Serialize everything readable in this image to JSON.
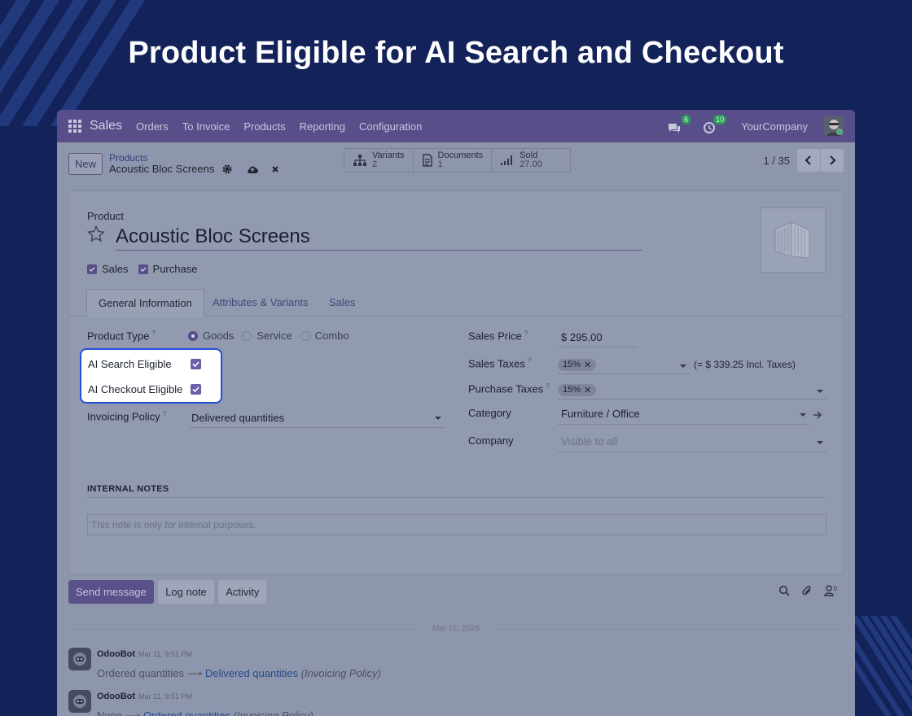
{
  "hero": {
    "title": "Product Eligible for AI Search and Checkout"
  },
  "navbar": {
    "brand": "Sales",
    "items": [
      "Orders",
      "To Invoice",
      "Products",
      "Reporting",
      "Configuration"
    ],
    "messages_count": "6",
    "activities_count": "10",
    "company": "YourCompany"
  },
  "control": {
    "new_label": "New",
    "breadcrumb_parent": "Products",
    "breadcrumb_current": "Acoustic Bloc Screens",
    "smart_buttons": [
      {
        "label": "Variants",
        "value": "2",
        "icon": "sitemap-icon"
      },
      {
        "label": "Documents",
        "value": "1",
        "icon": "document-icon"
      },
      {
        "label": "Sold",
        "value": "27.00",
        "icon": "bar-chart-icon"
      }
    ],
    "pager": "1 / 35"
  },
  "form": {
    "product_label": "Product",
    "product_name": "Acoustic Bloc Screens",
    "sales_check": "Sales",
    "purchase_check": "Purchase",
    "tabs": [
      "General Information",
      "Attributes & Variants",
      "Sales"
    ],
    "product_type_label": "Product Type",
    "product_type_options": [
      "Goods",
      "Service",
      "Combo"
    ],
    "product_type_selected": "Goods",
    "ai_search_label": "AI Search Eligible",
    "ai_checkout_label": "AI Checkout Eligible",
    "invoicing_policy_label": "Invoicing Policy",
    "invoicing_policy_value": "Delivered quantities",
    "sales_price_label": "Sales Price",
    "sales_price_value": "$ 295.00",
    "sales_taxes_label": "Sales Taxes",
    "sales_taxes_tag": "15%",
    "sales_taxes_incl": "(= $ 339.25 Incl. Taxes)",
    "purchase_taxes_label": "Purchase Taxes",
    "purchase_taxes_tag": "15%",
    "category_label": "Category",
    "category_value": "Furniture / Office",
    "company_label": "Company",
    "company_placeholder": "Visible to all",
    "internal_notes_heading": "INTERNAL NOTES",
    "internal_notes_placeholder": "This note is only for internal purposes."
  },
  "chatter": {
    "send_message": "Send message",
    "log_note": "Log note",
    "activity": "Activity",
    "followers_count": "0",
    "date_separator": "Mar 11, 2026",
    "messages": [
      {
        "author": "OdooBot",
        "time": "Mar 11, 9:51 PM",
        "old": "Ordered quantities",
        "new": "Delivered quantities",
        "field": "(Invoicing Policy)"
      },
      {
        "author": "OdooBot",
        "time": "Mar 11, 9:51 PM",
        "old": "None",
        "new": "Ordered quantities",
        "field": "(Invoicing Policy)"
      }
    ]
  },
  "colors": {
    "background": "#13235a",
    "navbar": "#584e8a",
    "highlight_border": "#2250d8"
  }
}
